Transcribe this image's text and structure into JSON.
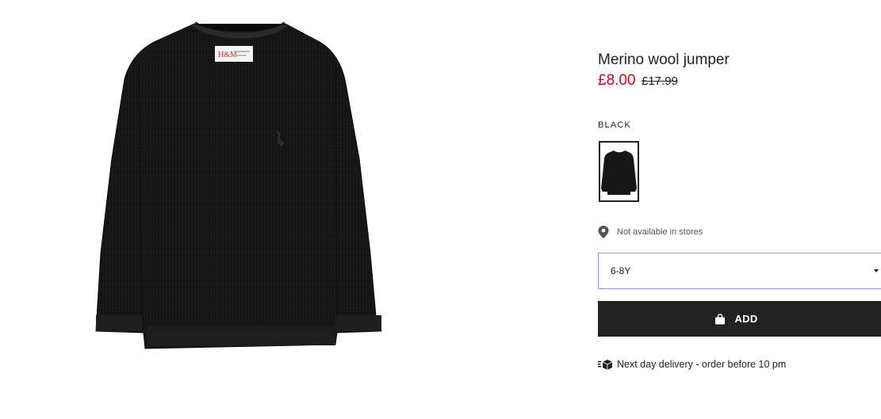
{
  "product": {
    "title": "Merino wool jumper",
    "sale_price": "£8.00",
    "original_price": "£17.99",
    "image_icon": "black-jumper-image",
    "brand_label_icon": "hm-label-icon"
  },
  "color": {
    "label": "BLACK",
    "swatch_icon": "black-jumper-thumbnail"
  },
  "availability": {
    "icon": "location-pin-icon",
    "text": "Not available in stores"
  },
  "size_select": {
    "selected": "6-8Y",
    "icon": "caret-down-icon"
  },
  "add_button": {
    "label": "ADD",
    "icon": "shopping-bag-icon"
  },
  "delivery": {
    "icon": "delivery-truck-icon",
    "text": "Next day delivery - order before 10 pm"
  },
  "colors": {
    "sale_price": "#d6001c",
    "button_background": "#222222",
    "select_border": "#7da2e8"
  }
}
